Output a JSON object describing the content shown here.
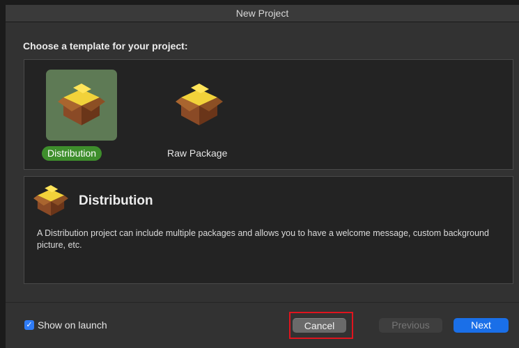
{
  "window": {
    "title": "New Project"
  },
  "chooser": {
    "heading": "Choose a template for your project:",
    "templates": [
      {
        "label": "Distribution",
        "selected": true
      },
      {
        "label": "Raw Package",
        "selected": false
      }
    ]
  },
  "description": {
    "title": "Distribution",
    "text": "A Distribution project can include multiple packages and allows you to have a welcome message, custom background picture, etc."
  },
  "footer": {
    "show_on_launch_label": "Show on launch",
    "show_on_launch_checked": true,
    "cancel_label": "Cancel",
    "previous_label": "Previous",
    "next_label": "Next"
  },
  "icons": {
    "package": "package-box-icon",
    "checkmark": "checkmark-icon"
  },
  "colors": {
    "selection_bg": "#5e7a55",
    "selection_label": "#3e8e2c",
    "primary_button": "#1a6fe8",
    "checkbox": "#2f7cf6",
    "cancel_highlight": "#e0141e"
  }
}
